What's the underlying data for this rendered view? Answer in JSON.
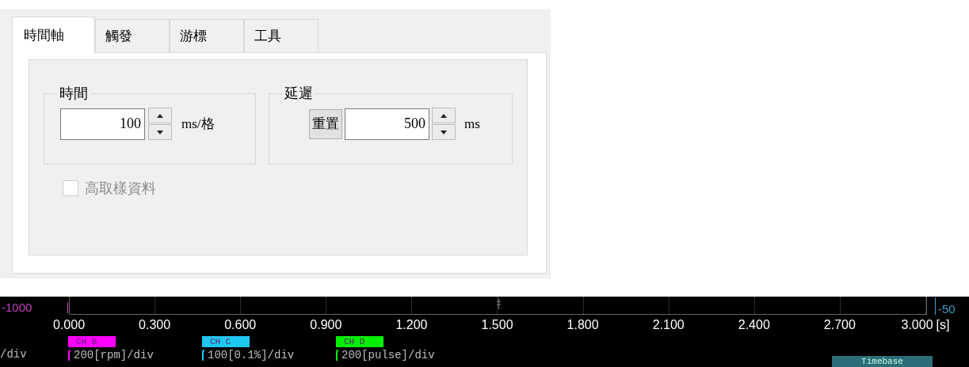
{
  "tabs": [
    {
      "label": "時間軸",
      "selected": true
    },
    {
      "label": "觸發",
      "selected": false
    },
    {
      "label": "游標",
      "selected": false
    },
    {
      "label": "工具",
      "selected": false
    }
  ],
  "time_group": {
    "title": "時間",
    "value": "100",
    "unit": "ms/格"
  },
  "delay_group": {
    "title": "延遲",
    "reset_button": "重置",
    "value": "500",
    "unit": "ms"
  },
  "high_sampling": {
    "label": "高取樣資料",
    "checked": false,
    "disabled": true
  },
  "scope": {
    "left_scale": "-1000",
    "right_scale": "-50",
    "ticks": [
      "0.000",
      "0.300",
      "0.600",
      "0.900",
      "1.200",
      "1.500",
      "1.800",
      "2.100",
      "2.400",
      "2.700",
      "3.000"
    ],
    "unit": "[s]",
    "partial_scale": "/div",
    "channels": [
      {
        "tag": "CH B",
        "color": "#ff00ff",
        "scale": "200[rpm]/div"
      },
      {
        "tag": "CH C",
        "color": "#1ec8f0",
        "scale": "100[0.1%]/div"
      },
      {
        "tag": "CH D",
        "color": "#00f000",
        "scale": "200[pulse]/div"
      }
    ],
    "timebase_button": "Timebase"
  }
}
